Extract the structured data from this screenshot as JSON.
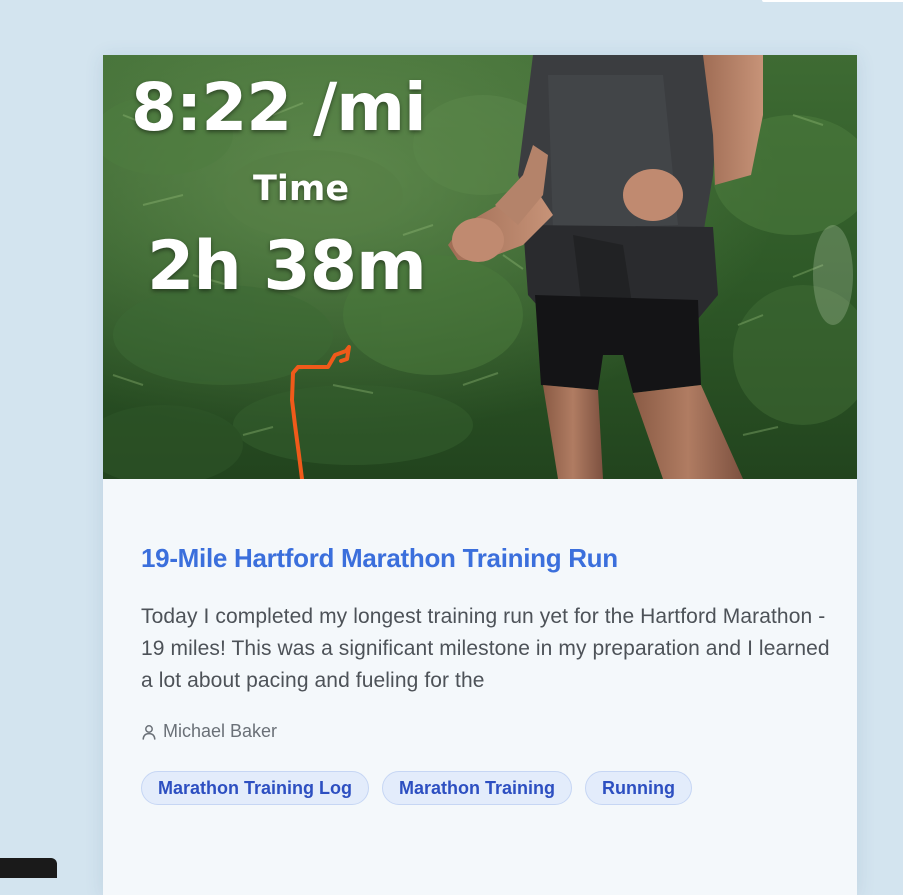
{
  "post": {
    "hero": {
      "pace": "8:22 /mi",
      "time_label": "Time",
      "time_value": "2h 38m"
    },
    "title": "19-Mile Hartford Marathon Training Run",
    "excerpt": "Today I completed my longest training run yet for the Hartford Marathon - 19 miles! This was a significant milestone in my preparation and I learned a lot about pacing and fueling for the",
    "author": "Michael Baker",
    "author_icon": "user-icon",
    "tags": [
      "Marathon Training Log",
      "Marathon Training",
      "Running"
    ]
  },
  "colors": {
    "background": "#d3e4ef",
    "card": "#f4f8fb",
    "title": "#3b6fdc",
    "tag_bg": "#e3ecfb",
    "tag_text": "#2d4fc1",
    "route": "#f05a1a"
  }
}
